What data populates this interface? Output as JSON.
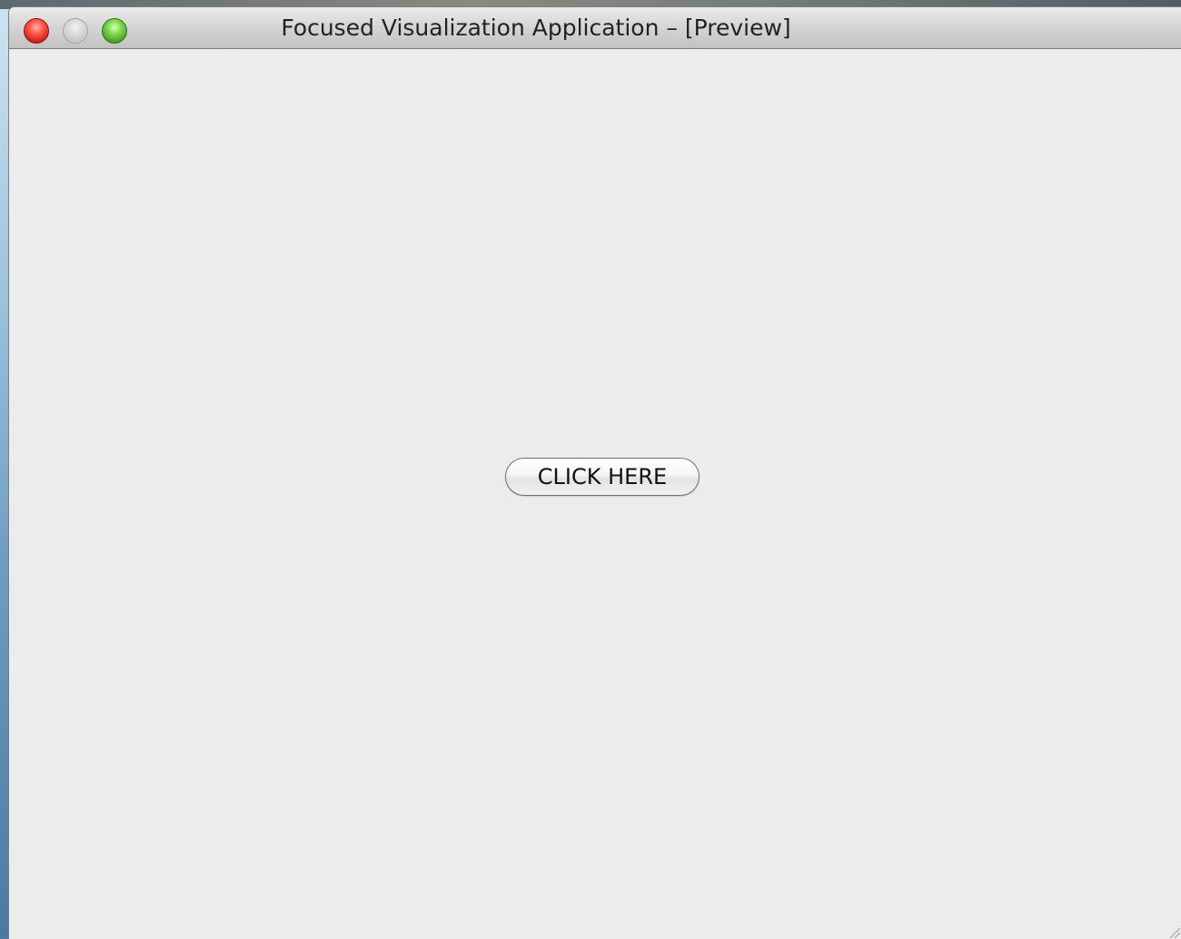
{
  "window": {
    "title": "Focused Visualization Application – [Preview]",
    "controls": {
      "close": "close-icon",
      "minimize": "minimize-icon",
      "zoom": "zoom-icon"
    }
  },
  "main": {
    "button_label": "CLICK HERE"
  },
  "colors": {
    "window_background": "#ececec",
    "close": "#ff5a4a",
    "minimize": "#d6d6d6",
    "zoom": "#7fdb4f"
  }
}
